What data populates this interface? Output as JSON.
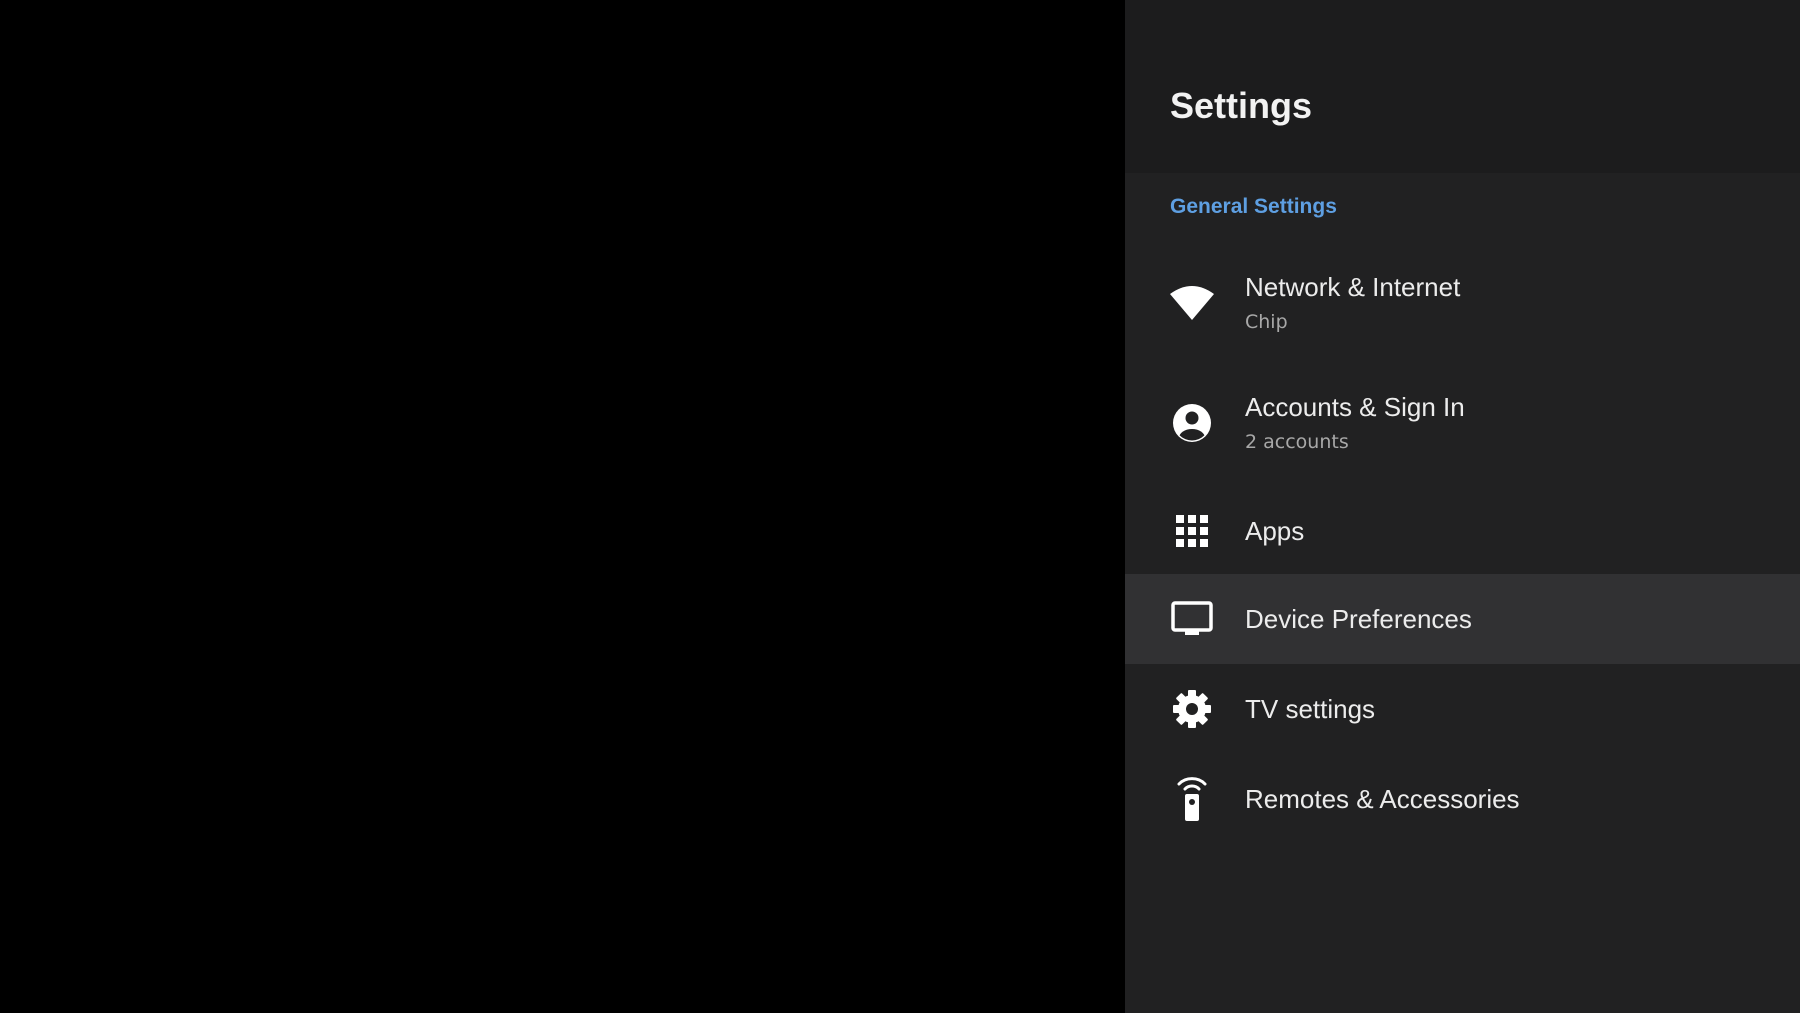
{
  "settings": {
    "title": "Settings",
    "section_label": "General Settings",
    "focused_item": "Device Preferences",
    "items": [
      {
        "id": "network",
        "title": "Network & Internet",
        "subtitle": "Chip",
        "icon": "wifi-icon"
      },
      {
        "id": "accounts",
        "title": "Accounts & Sign In",
        "subtitle": "2 accounts",
        "icon": "account-circle-icon"
      },
      {
        "id": "apps",
        "title": "Apps",
        "icon": "apps-grid-icon"
      },
      {
        "id": "device-preferences",
        "title": "Device Preferences",
        "icon": "tv-monitor-icon"
      },
      {
        "id": "tv-settings",
        "title": "TV settings",
        "icon": "gear-icon"
      },
      {
        "id": "remotes",
        "title": "Remotes & Accessories",
        "icon": "remote-control-icon"
      }
    ]
  },
  "colors": {
    "panel_background": "#212122",
    "header_background": "#1c1c1d",
    "focus_highlight": "#313133",
    "section_accent": "#5e9fe2",
    "primary_text": "#ececec",
    "secondary_text": "#a8a8a8",
    "backdrop": "#000000"
  }
}
